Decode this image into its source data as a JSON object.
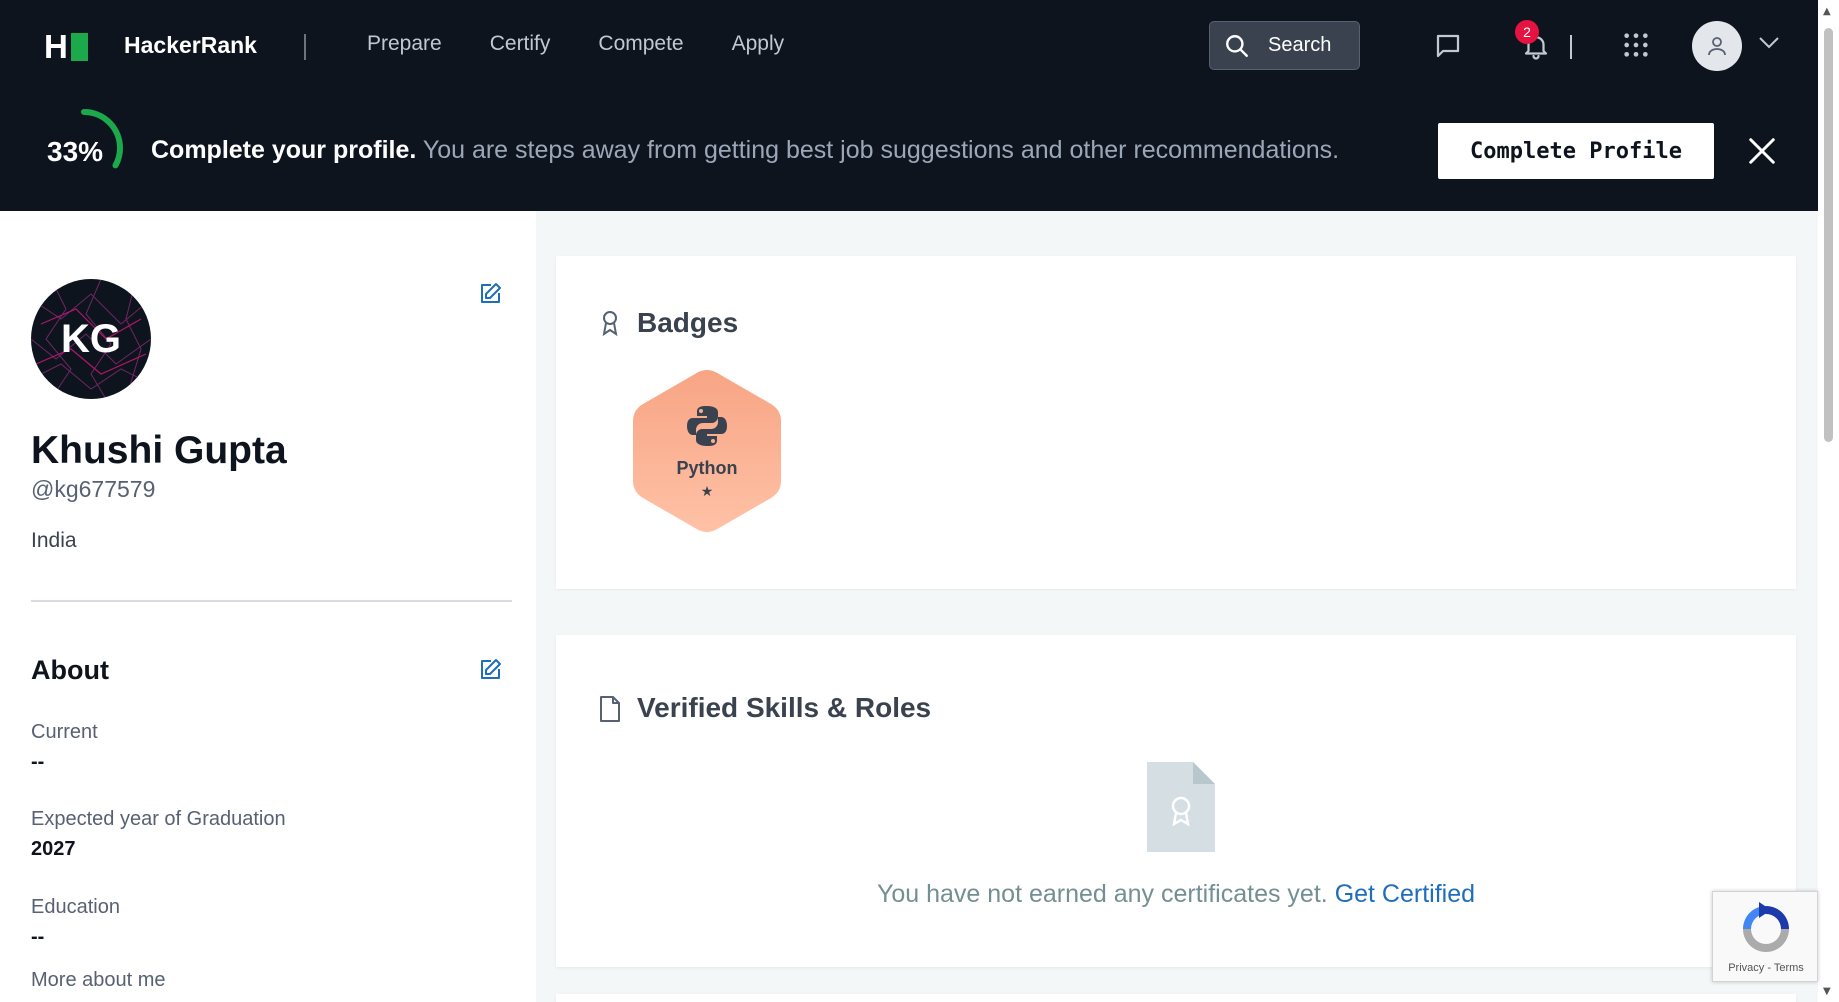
{
  "nav": {
    "logo_letter": "H",
    "brand": "HackerRank",
    "links": [
      "Prepare",
      "Certify",
      "Compete",
      "Apply"
    ],
    "search_label": "Search",
    "notification_count": "2"
  },
  "banner": {
    "progress_text": "33%",
    "progress_value": 0.33,
    "title": "Complete your profile.",
    "subtitle": "You are steps away from getting best job suggestions and other recommendations.",
    "button_label": "Complete Profile"
  },
  "profile": {
    "initials": "KG",
    "name": "Khushi Gupta",
    "handle": "@kg677579",
    "country": "India"
  },
  "about": {
    "title": "About",
    "fields": [
      {
        "label": "Current",
        "value": "--"
      },
      {
        "label": "Expected year of Graduation",
        "value": "2027"
      },
      {
        "label": "Education",
        "value": "--"
      },
      {
        "label": "More about me",
        "value": ""
      }
    ]
  },
  "badges": {
    "title": "Badges",
    "items": [
      {
        "name": "Python",
        "stars": "★"
      }
    ]
  },
  "skills": {
    "title": "Verified Skills & Roles",
    "empty_message": "You have not earned any certificates yet.",
    "cta": "Get Certified"
  },
  "recaptcha": {
    "text": "Privacy - Terms"
  },
  "colors": {
    "nav_bg": "#0e141e",
    "accent_green": "#1ba94c",
    "badge_fill": "#f9a78a",
    "link_blue": "#1f6dbd",
    "notif_red": "#e5133f"
  }
}
